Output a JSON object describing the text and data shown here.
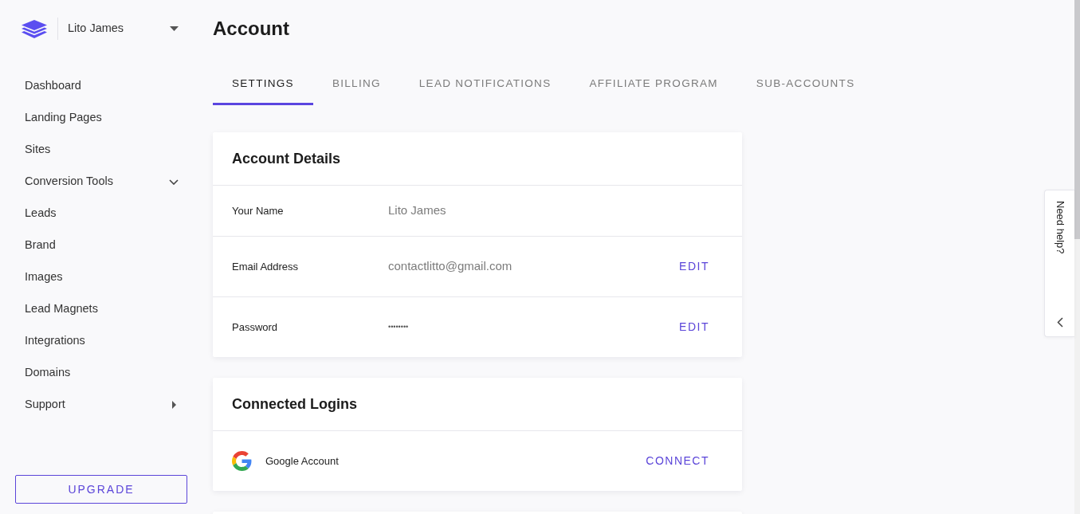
{
  "sidebar": {
    "user": {
      "name": "Lito James"
    },
    "items": [
      {
        "label": "Dashboard",
        "kind": "link"
      },
      {
        "label": "Landing Pages",
        "kind": "link"
      },
      {
        "label": "Sites",
        "kind": "link"
      },
      {
        "label": "Conversion Tools",
        "kind": "dropdown"
      },
      {
        "label": "Leads",
        "kind": "link"
      },
      {
        "label": "Brand",
        "kind": "link"
      },
      {
        "label": "Images",
        "kind": "link"
      },
      {
        "label": "Lead Magnets",
        "kind": "link"
      },
      {
        "label": "Integrations",
        "kind": "link"
      },
      {
        "label": "Domains",
        "kind": "link"
      },
      {
        "label": "Support",
        "kind": "flyout"
      }
    ],
    "upgrade_button": "UPGRADE"
  },
  "page": {
    "title": "Account"
  },
  "tabs": [
    {
      "label": "SETTINGS",
      "selected": true
    },
    {
      "label": "BILLING",
      "selected": false
    },
    {
      "label": "LEAD NOTIFICATIONS",
      "selected": false
    },
    {
      "label": "AFFILIATE PROGRAM",
      "selected": false
    },
    {
      "label": "SUB-ACCOUNTS",
      "selected": false
    }
  ],
  "cards": [
    {
      "title": "Account Details",
      "rows": [
        {
          "kind": "field",
          "label": "Your Name",
          "value": "Lito James"
        },
        {
          "kind": "field",
          "label": "Email Address",
          "value": "contactlitto@gmail.com",
          "action": "EDIT"
        },
        {
          "kind": "secret",
          "label": "Password",
          "value": "••••••••",
          "action": "EDIT"
        }
      ]
    },
    {
      "title": "Connected Logins",
      "rows": [
        {
          "kind": "provider",
          "label": "Google Account",
          "action": "CONNECT"
        }
      ]
    }
  ],
  "help_tab": {
    "label": "Need help?"
  }
}
